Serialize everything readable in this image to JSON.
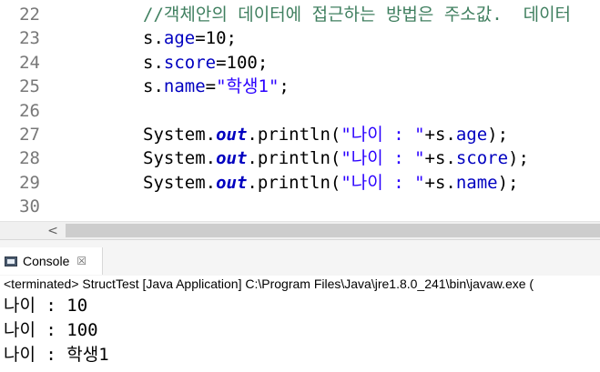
{
  "editor": {
    "lines": [
      {
        "number": "22",
        "tokens": [
          {
            "t": "//객체안의 데이터에 접근하는 방법은 주소값.  데이터",
            "c": "comment"
          }
        ]
      },
      {
        "number": "23",
        "tokens": [
          {
            "t": "s.",
            "c": "plain"
          },
          {
            "t": "age",
            "c": "field"
          },
          {
            "t": "=10;",
            "c": "plain"
          }
        ]
      },
      {
        "number": "24",
        "tokens": [
          {
            "t": "s.",
            "c": "plain"
          },
          {
            "t": "score",
            "c": "field"
          },
          {
            "t": "=100;",
            "c": "plain"
          }
        ]
      },
      {
        "number": "25",
        "tokens": [
          {
            "t": "s.",
            "c": "plain"
          },
          {
            "t": "name",
            "c": "field"
          },
          {
            "t": "=",
            "c": "plain"
          },
          {
            "t": "\"학생1\"",
            "c": "string"
          },
          {
            "t": ";",
            "c": "plain"
          }
        ]
      },
      {
        "number": "26",
        "tokens": []
      },
      {
        "number": "27",
        "tokens": [
          {
            "t": "System.",
            "c": "plain"
          },
          {
            "t": "out",
            "c": "static"
          },
          {
            "t": ".println(",
            "c": "plain"
          },
          {
            "t": "\"나이 : \"",
            "c": "string"
          },
          {
            "t": "+s.",
            "c": "plain"
          },
          {
            "t": "age",
            "c": "field"
          },
          {
            "t": ");",
            "c": "plain"
          }
        ]
      },
      {
        "number": "28",
        "tokens": [
          {
            "t": "System.",
            "c": "plain"
          },
          {
            "t": "out",
            "c": "static"
          },
          {
            "t": ".println(",
            "c": "plain"
          },
          {
            "t": "\"나이 : \"",
            "c": "string"
          },
          {
            "t": "+s.",
            "c": "plain"
          },
          {
            "t": "score",
            "c": "field"
          },
          {
            "t": ");",
            "c": "plain"
          }
        ]
      },
      {
        "number": "29",
        "tokens": [
          {
            "t": "System.",
            "c": "plain"
          },
          {
            "t": "out",
            "c": "static"
          },
          {
            "t": ".println(",
            "c": "plain"
          },
          {
            "t": "\"나이 : \"",
            "c": "string"
          },
          {
            "t": "+s.",
            "c": "plain"
          },
          {
            "t": "name",
            "c": "field"
          },
          {
            "t": ");",
            "c": "plain"
          }
        ]
      },
      {
        "number": "30",
        "tokens": []
      }
    ]
  },
  "scrollbar": {
    "left_arrow": "<"
  },
  "console": {
    "tab_label": "Console",
    "close_glyph": "☒",
    "status_line": "<terminated> StructTest [Java Application] C:\\Program Files\\Java\\jre1.8.0_241\\bin\\javaw.exe (",
    "output": [
      "나이 : 10",
      "나이 : 100",
      "나이 : 학생1"
    ]
  },
  "colors": {
    "comment": "#3f7f5f",
    "field": "#0000c0",
    "string": "#2a00ff",
    "line_number": "#787878"
  }
}
